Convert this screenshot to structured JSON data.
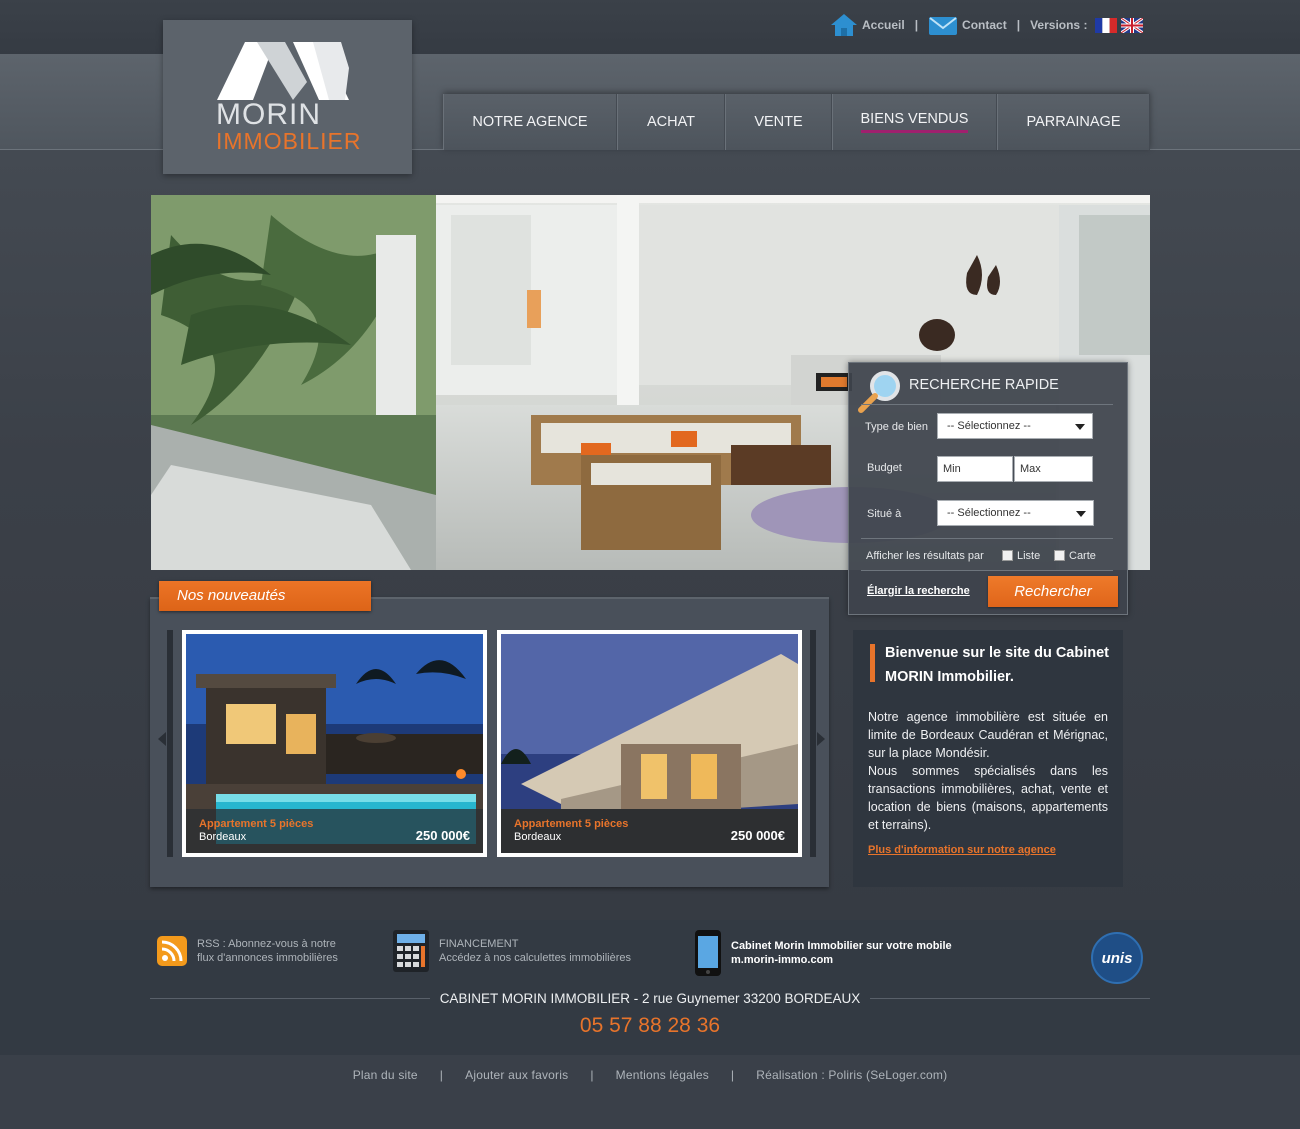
{
  "brand": {
    "line1": "MORIN",
    "line2": "IMMOBILIER",
    "accent": "#e8742b"
  },
  "toplinks": {
    "home": "Accueil",
    "contact": "Contact",
    "versions": "Versions :",
    "sep": "|"
  },
  "nav": {
    "items": [
      "NOTRE AGENCE",
      "ACHAT",
      "VENTE",
      "BIENS VENDUS",
      "PARRAINAGE"
    ],
    "active": "BIENS VENDUS"
  },
  "search": {
    "title": "RECHERCHE RAPIDE",
    "type_label": "Type de bien",
    "type_value": "-- Sélectionnez --",
    "budget_label": "Budget",
    "min_placeholder": "Min",
    "max_placeholder": "Max",
    "location_label": "Situé à",
    "location_value": "-- Sélectionnez --",
    "display_label": "Afficher les résultats par",
    "opt_list": "Liste",
    "opt_map": "Carte",
    "widen": "Élargir la recherche",
    "submit": "Rechercher"
  },
  "news": {
    "tab": "Nos nouveautés",
    "cards": [
      {
        "title": "Appartement 5 pièces",
        "location": "Bordeaux",
        "price": "250 000€"
      },
      {
        "title": "Appartement 5 pièces",
        "location": "Bordeaux",
        "price": "250 000€"
      }
    ]
  },
  "welcome": {
    "heading": "Bienvenue sur le site du Cabinet MORIN Immobilier.",
    "p1": "Notre agence immobilière est située en limite de Bordeaux Caudéran et Mérignac, sur la place Mondésir.",
    "p2": "Nous sommes spécialisés dans les transactions immobilières, achat, vente et location de biens (maisons, appartements et terrains).",
    "more": "Plus d'information sur notre agence"
  },
  "footer": {
    "rss": {
      "line1": "RSS : Abonnez-vous à notre",
      "line2": "flux d'annonces immobilières"
    },
    "finance": {
      "line1": "FINANCEMENT",
      "line2": "Accédez à nos calculettes immobilières"
    },
    "mobile": {
      "line1": "Cabinet Morin Immobilier sur votre mobile",
      "line2": "m.morin-immo.com"
    },
    "unis": "unis",
    "address": "CABINET MORIN IMMOBILIER - 2 rue Guynemer 33200 BORDEAUX",
    "phone": "05 57 88 28 36",
    "links": [
      "Plan du site",
      "Ajouter aux favoris",
      "Mentions légales",
      "Réalisation : Poliris (SeLoger.com)"
    ]
  }
}
